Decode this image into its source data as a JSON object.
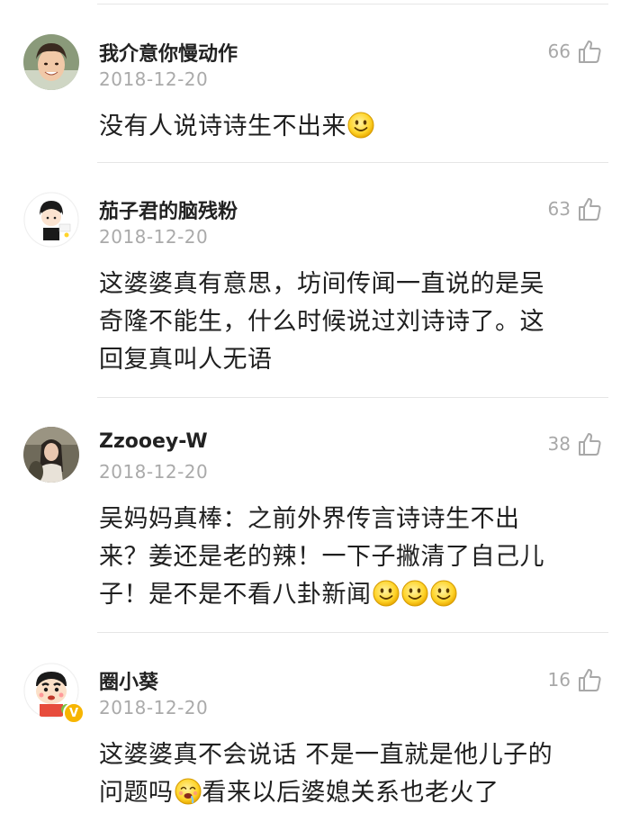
{
  "comments": [
    {
      "username": "我介意你慢动作",
      "date": "2018-12-20",
      "likes": "66",
      "text": "没有人说诗诗生不出来",
      "emojis": [
        "smile"
      ],
      "avatar": "photo-young-man-avatar"
    },
    {
      "username": "茄子君的脑残粉",
      "date": "2018-12-20",
      "likes": "63",
      "text_lines": [
        "这婆婆真有意思，坊间传闻一直说的是吴",
        "奇隆不能生，什么时候说过刘诗诗了。这",
        "回复真叫人无语"
      ],
      "avatar": "cartoon-boy-avatar"
    },
    {
      "username": "Zzooey-W",
      "date": "2018-12-20",
      "likes": "38",
      "text_lines": [
        "吴妈妈真棒：之前外界传言诗诗生不出",
        "来？姜还是老的辣！一下子撇清了自己儿",
        "子！是不是不看八卦新闻"
      ],
      "emojis": [
        "smile",
        "smile",
        "smile"
      ],
      "avatar": "photo-girl-avatar"
    },
    {
      "username": "圈小葵",
      "date": "2018-12-20",
      "likes": "16",
      "text_lines": [
        "这婆婆真不会说话 不是一直就是他儿子的",
        "问题吗",
        "看来以后婆媳关系也老火了"
      ],
      "emojis": [
        "drooling-face"
      ],
      "avatar": "crayon-shinchan-avatar",
      "verified_badge": "V"
    }
  ],
  "icons": {
    "like": "thumbs-up-outline-icon"
  },
  "colors": {
    "meta_gray": "#aaaaaa",
    "like_gray": "#a8a8a8",
    "divider": "#e6e6e6",
    "badge": "#f7b500"
  }
}
